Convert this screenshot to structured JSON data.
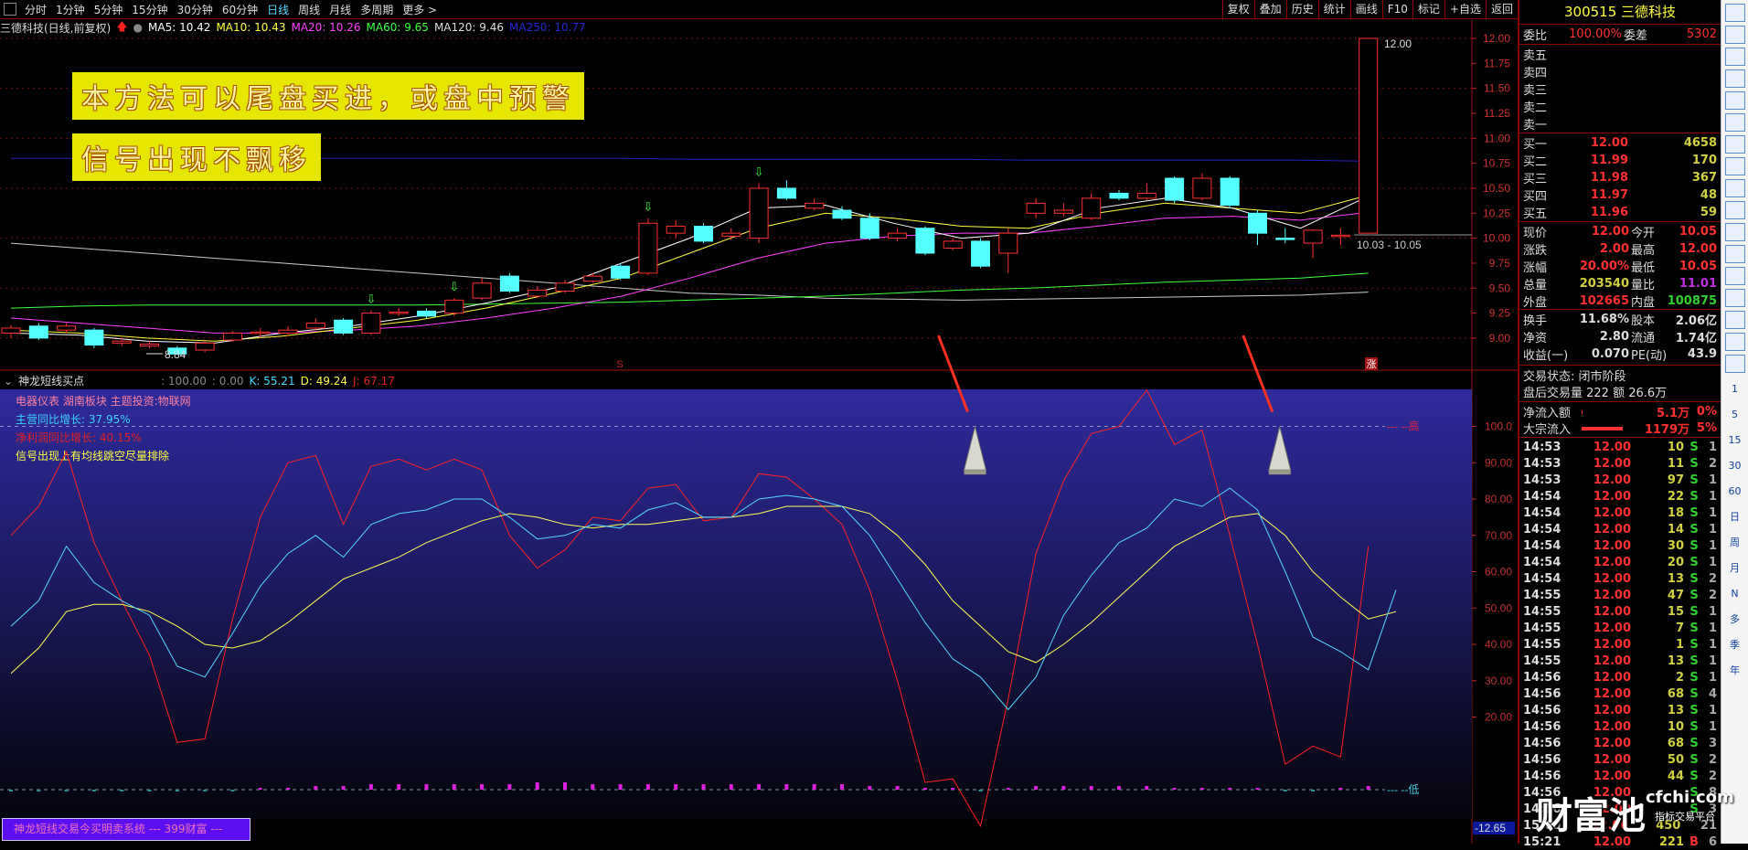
{
  "toolbar": {
    "periods": [
      "分时",
      "1分钟",
      "5分钟",
      "15分钟",
      "30分钟",
      "60分钟",
      "日线",
      "周线",
      "月线",
      "多周期",
      "更多 >"
    ],
    "active": "日线",
    "right_buttons": [
      "复权",
      "叠加",
      "历史",
      "统计",
      "画线",
      "F10",
      "标记",
      "+自选",
      "返回"
    ]
  },
  "ma_header": {
    "title": "三德科技(日线,前复权)",
    "ma5": "MA5: 10.42",
    "ma10": "MA10: 10.43",
    "ma20": "MA20: 10.26",
    "ma60": "MA60: 9.65",
    "ma120": "MA120: 9.46",
    "ma250": "MA250: 10.77"
  },
  "colors": {
    "up": "#ff3030",
    "down": "#54ffff",
    "ma5": "#ffffff",
    "ma10": "#ffff40",
    "ma20": "#ff40ff",
    "ma60": "#40ff40",
    "ma120": "#c8c8c8",
    "ma250": "#2020c0",
    "k": "#54d8ff",
    "d": "#ffff50",
    "j": "#ff2020"
  },
  "annotations": {
    "box1": "本方法可以尾盘买进，或盘中预警",
    "box2": "信号出现不飘移",
    "high_label": "12.00",
    "low_label": "8.84",
    "range_label": "10.03 - 10.05",
    "limit_up_badge": "涨",
    "marker_s": "S"
  },
  "indicator": {
    "name": "神龙短线买点",
    "v1": ": 100.00",
    "v2": ": 0.00",
    "k": "K: 55.21",
    "d": "D: 49.24",
    "j": "J: 67.17",
    "line1": "电器仪表 湖南板块 主题投资:物联网",
    "line2": "主营同比增长: 37.95%",
    "line3": "净利润同比增长: 40.15%",
    "line4": "信号出现上有均线跳空尽量排除",
    "high_mark": "--- --高",
    "low_mark": "--- --低",
    "axis_bottom": "-12.65",
    "footer": "神龙短线交易今买明卖系统 --- 399财富 ---"
  },
  "quote": {
    "code_name": "300515 三德科技",
    "weibi_label": "委比",
    "weibi": "100.00%",
    "weicha_label": "委差",
    "weicha": "5302",
    "sells": [
      {
        "label": "卖五"
      },
      {
        "label": "卖四"
      },
      {
        "label": "卖三"
      },
      {
        "label": "卖二"
      },
      {
        "label": "卖一"
      }
    ],
    "buys": [
      {
        "label": "买一",
        "price": "12.00",
        "vol": "4658"
      },
      {
        "label": "买二",
        "price": "11.99",
        "vol": "170"
      },
      {
        "label": "买三",
        "price": "11.98",
        "vol": "367"
      },
      {
        "label": "买四",
        "price": "11.97",
        "vol": "48"
      },
      {
        "label": "买五",
        "price": "11.96",
        "vol": "59"
      }
    ],
    "stats": [
      {
        "l1": "现价",
        "v1": "12.00",
        "l2": "今开",
        "v2": "10.05"
      },
      {
        "l1": "涨跌",
        "v1": "2.00",
        "l2": "最高",
        "v2": "12.00"
      },
      {
        "l1": "涨幅",
        "v1": "20.00%",
        "l2": "最低",
        "v2": "10.05"
      },
      {
        "l1": "总量",
        "v1": "203540",
        "l2": "量比",
        "v2": "11.01"
      },
      {
        "l1": "外盘",
        "v1": "102665",
        "l2": "内盘",
        "v2": "100875"
      }
    ],
    "fund": [
      {
        "l1": "换手",
        "v1": "11.68%",
        "l2": "股本",
        "v2": "2.06亿"
      },
      {
        "l1": "净资",
        "v1": "2.80",
        "l2": "流通",
        "v2": "1.74亿"
      },
      {
        "l1": "收益(一)",
        "v1": "0.070",
        "l2": "PE(动)",
        "v2": "43.9"
      }
    ],
    "status": "交易状态: 闭市阶段",
    "after_hours": "盘后交易量 222 额 26.6万",
    "flow": [
      {
        "label": "净流入额",
        "value": "5.1万",
        "pct": "0%",
        "bar": 0.01
      },
      {
        "label": "大宗流入",
        "value": "1179万",
        "pct": "5%",
        "bar": 0.8
      }
    ],
    "trades": [
      [
        "14:53",
        "12.00",
        "10",
        "S",
        "1"
      ],
      [
        "14:53",
        "12.00",
        "11",
        "S",
        "2"
      ],
      [
        "14:53",
        "12.00",
        "97",
        "S",
        "1"
      ],
      [
        "14:54",
        "12.00",
        "22",
        "S",
        "1"
      ],
      [
        "14:54",
        "12.00",
        "18",
        "S",
        "1"
      ],
      [
        "14:54",
        "12.00",
        "14",
        "S",
        "1"
      ],
      [
        "14:54",
        "12.00",
        "30",
        "S",
        "1"
      ],
      [
        "14:54",
        "12.00",
        "20",
        "S",
        "1"
      ],
      [
        "14:54",
        "12.00",
        "13",
        "S",
        "2"
      ],
      [
        "14:55",
        "12.00",
        "47",
        "S",
        "2"
      ],
      [
        "14:55",
        "12.00",
        "15",
        "S",
        "1"
      ],
      [
        "14:55",
        "12.00",
        "7",
        "S",
        "1"
      ],
      [
        "14:55",
        "12.00",
        "1",
        "S",
        "1"
      ],
      [
        "14:55",
        "12.00",
        "13",
        "S",
        "1"
      ],
      [
        "14:56",
        "12.00",
        "2",
        "S",
        "1"
      ],
      [
        "14:56",
        "12.00",
        "68",
        "S",
        "4"
      ],
      [
        "14:56",
        "12.00",
        "13",
        "S",
        "1"
      ],
      [
        "14:56",
        "12.00",
        "10",
        "S",
        "1"
      ],
      [
        "14:56",
        "12.00",
        "68",
        "S",
        "3"
      ],
      [
        "14:56",
        "12.00",
        "50",
        "S",
        "2"
      ],
      [
        "14:56",
        "12.00",
        "44",
        "S",
        "2"
      ],
      [
        "14:56",
        "12.00",
        "",
        "S",
        "8"
      ],
      [
        "14:56",
        "12.00",
        "",
        "S",
        "3"
      ],
      [
        "15:00",
        "12.00",
        "450",
        "",
        "21"
      ],
      [
        "15:21",
        "12.00",
        "221",
        "B",
        "6"
      ]
    ]
  },
  "side_strip": [
    "1",
    "5",
    "15",
    "30",
    "60",
    "日",
    "周",
    "月",
    "N",
    "多",
    "季",
    "年"
  ],
  "watermark": {
    "brand": "财富池",
    "site": "cfchi.com",
    "slogan": "指标交易平台"
  },
  "chart_data": [
    {
      "type": "candlestick",
      "title": "三德科技 日线",
      "ylim": [
        8.75,
        12.1
      ],
      "yticks": [
        9.0,
        9.25,
        9.5,
        9.75,
        10.0,
        10.25,
        10.5,
        10.75,
        11.0,
        11.25,
        11.5,
        11.75,
        12.0
      ],
      "candles": [
        [
          9.05,
          9.1,
          9.13,
          9.0
        ],
        [
          9.12,
          9.0,
          9.15,
          8.98
        ],
        [
          9.08,
          9.12,
          9.15,
          9.05
        ],
        [
          9.08,
          8.93,
          9.1,
          8.9
        ],
        [
          8.95,
          8.97,
          9.0,
          8.92
        ],
        [
          8.92,
          8.94,
          8.97,
          8.9
        ],
        [
          8.9,
          8.84,
          8.92,
          8.84
        ],
        [
          8.88,
          8.95,
          8.97,
          8.86
        ],
        [
          8.98,
          9.05,
          9.07,
          8.96
        ],
        [
          9.05,
          9.06,
          9.1,
          9.0
        ],
        [
          9.05,
          9.08,
          9.12,
          9.02
        ],
        [
          9.1,
          9.15,
          9.2,
          9.08
        ],
        [
          9.18,
          9.05,
          9.2,
          9.03
        ],
        [
          9.05,
          9.25,
          9.28,
          9.03
        ],
        [
          9.25,
          9.26,
          9.3,
          9.22
        ],
        [
          9.27,
          9.22,
          9.3,
          9.2
        ],
        [
          9.25,
          9.38,
          9.4,
          9.22
        ],
        [
          9.4,
          9.55,
          9.6,
          9.38
        ],
        [
          9.62,
          9.47,
          9.65,
          9.45
        ],
        [
          9.42,
          9.48,
          9.52,
          9.4
        ],
        [
          9.47,
          9.55,
          9.58,
          9.45
        ],
        [
          9.57,
          9.62,
          9.65,
          9.55
        ],
        [
          9.72,
          9.6,
          9.75,
          9.58
        ],
        [
          9.65,
          10.15,
          10.2,
          9.63
        ],
        [
          10.05,
          10.12,
          10.18,
          10.0
        ],
        [
          10.12,
          9.97,
          10.15,
          9.95
        ],
        [
          10.02,
          10.05,
          10.1,
          9.98
        ],
        [
          10.0,
          10.5,
          10.55,
          9.95
        ],
        [
          10.5,
          10.4,
          10.58,
          10.38
        ],
        [
          10.3,
          10.35,
          10.4,
          10.28
        ],
        [
          10.28,
          10.2,
          10.32,
          10.18
        ],
        [
          10.2,
          10.0,
          10.25,
          9.98
        ],
        [
          10.0,
          10.05,
          10.1,
          9.97
        ],
        [
          10.1,
          9.85,
          10.12,
          9.83
        ],
        [
          9.9,
          9.97,
          10.0,
          9.88
        ],
        [
          9.97,
          9.72,
          10.0,
          9.7
        ],
        [
          9.85,
          10.05,
          10.1,
          9.65
        ],
        [
          10.25,
          10.35,
          10.4,
          10.2
        ],
        [
          10.25,
          10.28,
          10.35,
          10.22
        ],
        [
          10.2,
          10.4,
          10.45,
          10.18
        ],
        [
          10.45,
          10.4,
          10.48,
          10.38
        ],
        [
          10.4,
          10.45,
          10.55,
          10.38
        ],
        [
          10.6,
          10.38,
          10.62,
          10.35
        ],
        [
          10.4,
          10.6,
          10.65,
          10.38
        ],
        [
          10.6,
          10.33,
          10.62,
          10.3
        ],
        [
          10.25,
          10.05,
          10.28,
          9.93
        ],
        [
          10.0,
          9.99,
          10.1,
          9.95
        ],
        [
          9.95,
          10.08,
          10.09,
          9.8
        ],
        [
          10.03,
          10.03,
          10.1,
          9.93
        ],
        [
          10.05,
          12.0,
          12.0,
          10.05
        ]
      ],
      "down_markers": [
        13,
        16,
        23,
        27
      ],
      "ma": {
        "ma5": [
          9.05,
          9.03,
          8.97,
          8.95,
          9.05,
          9.12,
          9.22,
          9.35,
          9.5,
          9.75,
          10.0,
          10.3,
          10.33,
          10.15,
          10.0,
          10.05,
          10.3,
          10.4,
          10.3,
          10.1,
          10.42
        ],
        "ma10": [
          9.08,
          9.05,
          9.0,
          8.97,
          9.02,
          9.1,
          9.18,
          9.3,
          9.45,
          9.6,
          9.85,
          10.1,
          10.25,
          10.2,
          10.12,
          10.1,
          10.25,
          10.35,
          10.3,
          10.25,
          10.43
        ],
        "ma20": [
          9.2,
          9.15,
          9.1,
          9.05,
          9.05,
          9.08,
          9.12,
          9.2,
          9.3,
          9.42,
          9.6,
          9.8,
          9.95,
          10.02,
          10.05,
          10.05,
          10.12,
          10.2,
          10.22,
          10.18,
          10.26
        ],
        "ma60": [
          9.3,
          9.32,
          9.33,
          9.33,
          9.33,
          9.33,
          9.33,
          9.34,
          9.35,
          9.36,
          9.38,
          9.4,
          9.42,
          9.45,
          9.48,
          9.5,
          9.53,
          9.56,
          9.58,
          9.6,
          9.65
        ],
        "ma120": [
          9.95,
          9.9,
          9.85,
          9.8,
          9.75,
          9.7,
          9.65,
          9.6,
          9.55,
          9.5,
          9.45,
          9.43,
          9.4,
          9.39,
          9.38,
          9.39,
          9.4,
          9.41,
          9.42,
          9.43,
          9.46
        ],
        "ma250": [
          10.8,
          10.8,
          10.8,
          10.8,
          10.8,
          10.8,
          10.8,
          10.8,
          10.8,
          10.8,
          10.79,
          10.79,
          10.79,
          10.79,
          10.79,
          10.78,
          10.78,
          10.78,
          10.78,
          10.78,
          10.77
        ]
      }
    },
    {
      "type": "line",
      "title": "神龙短线买点 KDJ",
      "ylim": [
        -12.65,
        110
      ],
      "yticks": [
        20,
        30,
        40,
        50,
        60,
        70,
        80,
        90,
        100
      ],
      "series": [
        {
          "name": "K",
          "values": [
            45,
            52,
            67,
            57,
            52,
            48,
            34,
            31,
            43,
            56,
            65,
            70,
            64,
            73,
            76,
            77,
            80,
            80,
            75,
            69,
            70,
            73,
            72,
            77,
            79,
            75,
            75,
            80,
            81,
            80,
            78,
            70,
            58,
            46,
            36,
            31,
            22,
            31,
            48,
            59,
            68,
            72,
            80,
            78,
            83,
            77,
            60,
            42,
            38,
            33,
            55
          ]
        },
        {
          "name": "D",
          "values": [
            32,
            39,
            49,
            51,
            51,
            49,
            45,
            40,
            39,
            41,
            46,
            52,
            58,
            61,
            64,
            68,
            71,
            74,
            76,
            75,
            73,
            72,
            73,
            73,
            74,
            75,
            75,
            76,
            78,
            78,
            78,
            76,
            70,
            62,
            52,
            45,
            38,
            35,
            40,
            46,
            53,
            60,
            67,
            71,
            75,
            76,
            70,
            60,
            53,
            47,
            49
          ]
        },
        {
          "name": "J",
          "values": [
            70,
            78,
            93,
            68,
            52,
            37,
            13,
            14,
            47,
            75,
            90,
            92,
            73,
            89,
            91,
            88,
            91,
            88,
            70,
            61,
            66,
            75,
            74,
            83,
            84,
            74,
            75,
            87,
            86,
            80,
            73,
            55,
            30,
            2,
            3,
            -10,
            25,
            65,
            85,
            98,
            100,
            110,
            95,
            99,
            70,
            40,
            7,
            12,
            9,
            67
          ]
        }
      ],
      "signals": [
        35,
        46
      ],
      "bars": [
        0,
        0,
        0,
        0,
        0,
        0,
        0,
        0,
        0,
        1,
        1,
        2,
        2,
        3,
        3,
        3,
        3,
        3,
        3,
        4,
        4,
        3,
        3,
        3,
        3,
        3,
        3,
        3,
        3,
        3,
        3,
        2,
        2,
        1,
        1,
        0,
        1,
        2,
        2,
        2,
        2,
        2,
        1,
        1,
        1,
        1,
        0,
        0,
        1,
        2
      ]
    }
  ]
}
